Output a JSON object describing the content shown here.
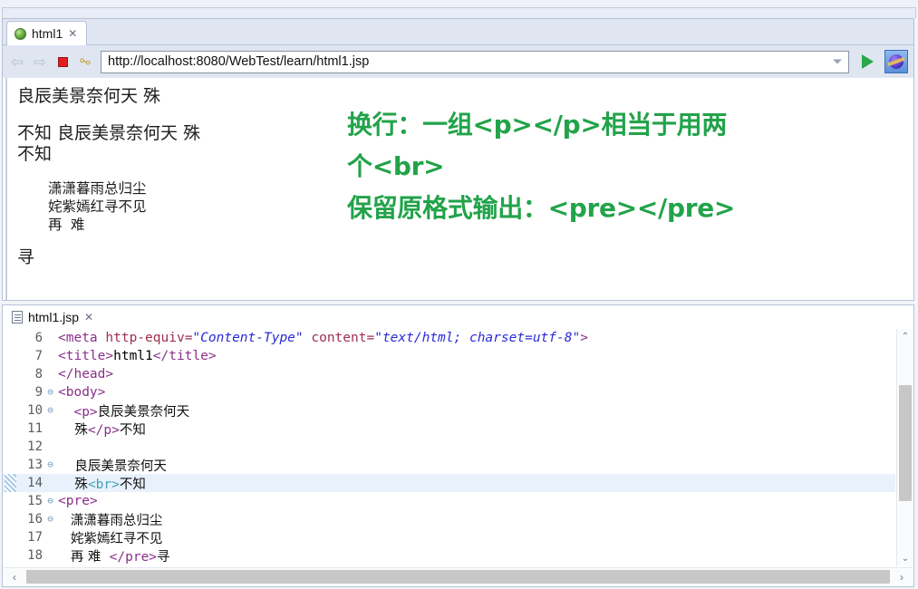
{
  "window": {
    "minimize_label": "_",
    "maximize_label": "□"
  },
  "browser": {
    "tab": {
      "icon": "globe-icon",
      "label": "html1",
      "close_label": "✕"
    },
    "toolbar": {
      "back_label": "⇦",
      "forward_label": "⇨",
      "stop_label": "stop-icon",
      "refresh_label": "⚯",
      "go_label": "go-icon",
      "open_external_label": "open-external-browser-icon"
    },
    "url": {
      "value": "http://localhost:8080/WebTest/learn/html1.jsp",
      "placeholder": "http://"
    },
    "rendered_page": {
      "paragraph_line1": "良辰美景奈何天 殊",
      "body_line1": "不知 良辰美景奈何天 殊",
      "body_line2": "不知",
      "pre_line1": "潇潇暮雨总归尘",
      "pre_line2": "姹紫嫣红寻不见",
      "pre_line3": "再 难",
      "trailing_text": "寻"
    },
    "annotation": {
      "line1": "换行：一组<p></p>相当于用两",
      "line2": "个<br>",
      "line3": "保留原格式输出：<pre></pre>",
      "color": "#22a34a"
    }
  },
  "editor": {
    "tab": {
      "icon": "file-icon",
      "label": "html1.jsp",
      "close_label": "✕"
    },
    "lines": [
      {
        "number": "6",
        "fold": "",
        "current": false,
        "tokens": [
          {
            "t": "tok-tag",
            "s": "<meta "
          },
          {
            "t": "tok-attr",
            "s": "http-equiv="
          },
          {
            "t": "tok-val",
            "s": "\"Content-Type\""
          },
          {
            "t": "tok-attr",
            "s": " content="
          },
          {
            "t": "tok-val",
            "s": "\"text/html; charset=utf-8\""
          },
          {
            "t": "tok-tag",
            "s": ">"
          }
        ]
      },
      {
        "number": "7",
        "fold": "",
        "current": false,
        "tokens": [
          {
            "t": "tok-tag",
            "s": "<title>"
          },
          {
            "t": "tok-plain",
            "s": "html1"
          },
          {
            "t": "tok-tag",
            "s": "</title>"
          }
        ]
      },
      {
        "number": "8",
        "fold": "",
        "current": false,
        "tokens": [
          {
            "t": "tok-tag",
            "s": "</head>"
          }
        ]
      },
      {
        "number": "9",
        "fold": "⊖",
        "current": false,
        "tokens": [
          {
            "t": "tok-tag",
            "s": "<body>"
          }
        ]
      },
      {
        "number": "10",
        "fold": "⊖",
        "current": false,
        "tokens": [
          {
            "t": "tok-plain",
            "s": "  "
          },
          {
            "t": "tok-tag",
            "s": "<p>"
          },
          {
            "t": "tok-cjk",
            "s": "良辰美景奈何天"
          }
        ]
      },
      {
        "number": "11",
        "fold": "",
        "current": false,
        "tokens": [
          {
            "t": "tok-cjk",
            "s": "    殊"
          },
          {
            "t": "tok-tag",
            "s": "</p>"
          },
          {
            "t": "tok-cjk",
            "s": "不知"
          }
        ]
      },
      {
        "number": "12",
        "fold": "",
        "current": false,
        "tokens": [
          {
            "t": "tok-plain",
            "s": ""
          }
        ]
      },
      {
        "number": "13",
        "fold": "⊖",
        "current": false,
        "tokens": [
          {
            "t": "tok-cjk",
            "s": "    良辰美景奈何天"
          }
        ]
      },
      {
        "number": "14",
        "fold": "",
        "current": true,
        "tokens": [
          {
            "t": "tok-cjk",
            "s": "    殊"
          },
          {
            "t": "tok-brtag",
            "s": "<br>"
          },
          {
            "t": "tok-cjk",
            "s": "不知"
          }
        ]
      },
      {
        "number": "15",
        "fold": "⊖",
        "current": false,
        "tokens": [
          {
            "t": "tok-tag",
            "s": "<pre>"
          }
        ]
      },
      {
        "number": "16",
        "fold": "⊖",
        "current": false,
        "tokens": [
          {
            "t": "tok-cjk",
            "s": "   潇潇暮雨总归尘"
          }
        ]
      },
      {
        "number": "17",
        "fold": "",
        "current": false,
        "tokens": [
          {
            "t": "tok-cjk",
            "s": "   姹紫嫣红寻不见"
          }
        ]
      },
      {
        "number": "18",
        "fold": "",
        "current": false,
        "tokens": [
          {
            "t": "tok-cjk",
            "s": "   再 难  "
          },
          {
            "t": "tok-tag",
            "s": "</pre>"
          },
          {
            "t": "tok-cjk",
            "s": "寻"
          }
        ]
      }
    ],
    "scrollbars": {
      "up_label": "⌃",
      "down_label": "⌄",
      "left_label": "‹",
      "right_label": "›"
    }
  }
}
